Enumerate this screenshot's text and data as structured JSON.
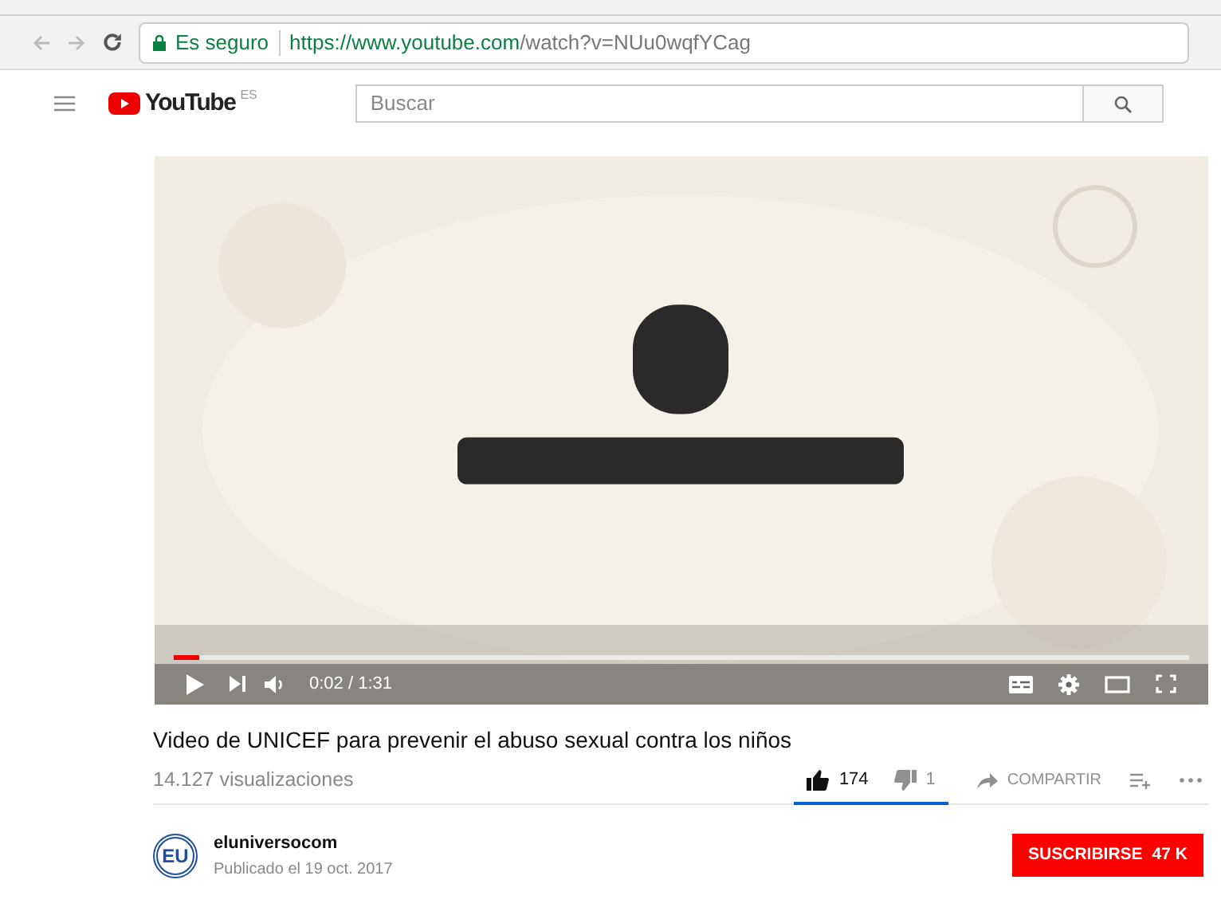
{
  "browser": {
    "secure_label": "Es seguro",
    "url_host": "https://www.youtube.com",
    "url_path": "/watch?v=NUu0wqfYCag"
  },
  "header": {
    "logo_text": "YouTube",
    "region": "ES",
    "search": {
      "placeholder": "Buscar"
    }
  },
  "player": {
    "progress": {
      "level": 0.025
    },
    "time": "0:02 / 1:31"
  },
  "video": {
    "title": "Video de UNICEF para prevenir el abuso sexual contra los niños",
    "views": "14.127 visualizaciones",
    "likes": {
      "count": "174",
      "selected": true
    },
    "dislikes": {
      "count": "1",
      "selected": false
    },
    "share": "COMPARTIR"
  },
  "channel": {
    "avatar_text": "EU",
    "name": "eluniversocom",
    "published": "Publicado el 19 oct. 2017",
    "subscribe": "SUSCRIBIRSE",
    "subscribers": "47 K"
  }
}
